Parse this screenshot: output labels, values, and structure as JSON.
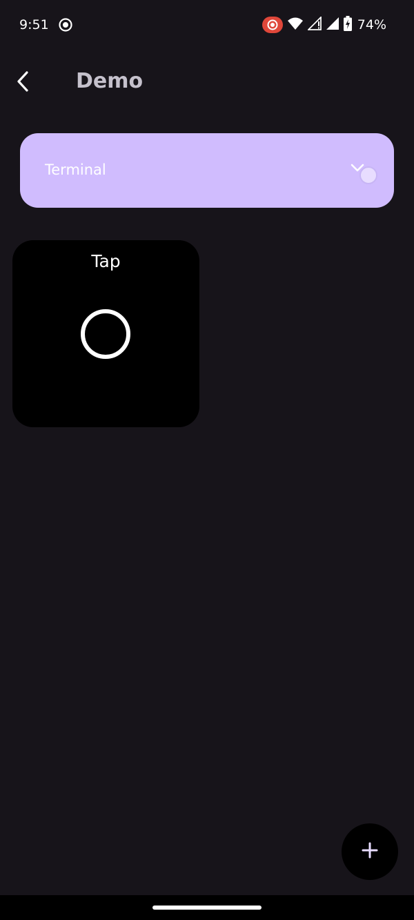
{
  "status_bar": {
    "time": "9:51",
    "battery_percent": "74%",
    "icons": [
      "screen-record-icon",
      "cast-icon",
      "wifi-icon",
      "signal-no-data-icon",
      "signal-icon",
      "battery-charging-icon"
    ]
  },
  "app_bar": {
    "title": "Demo",
    "back_icon": "back-arrow-icon"
  },
  "terminal_card": {
    "label": "Terminal",
    "expand_icon": "chevron-down-icon",
    "color": "#d0bcfe"
  },
  "tiles": [
    {
      "label": "Tap",
      "icon": "circle-icon"
    }
  ],
  "fab": {
    "icon": "plus-icon"
  },
  "colors": {
    "background": "#17141a",
    "title": "#c5c1cc",
    "accent": "#d0bcfe",
    "cast_indicator": "#e0473a"
  }
}
